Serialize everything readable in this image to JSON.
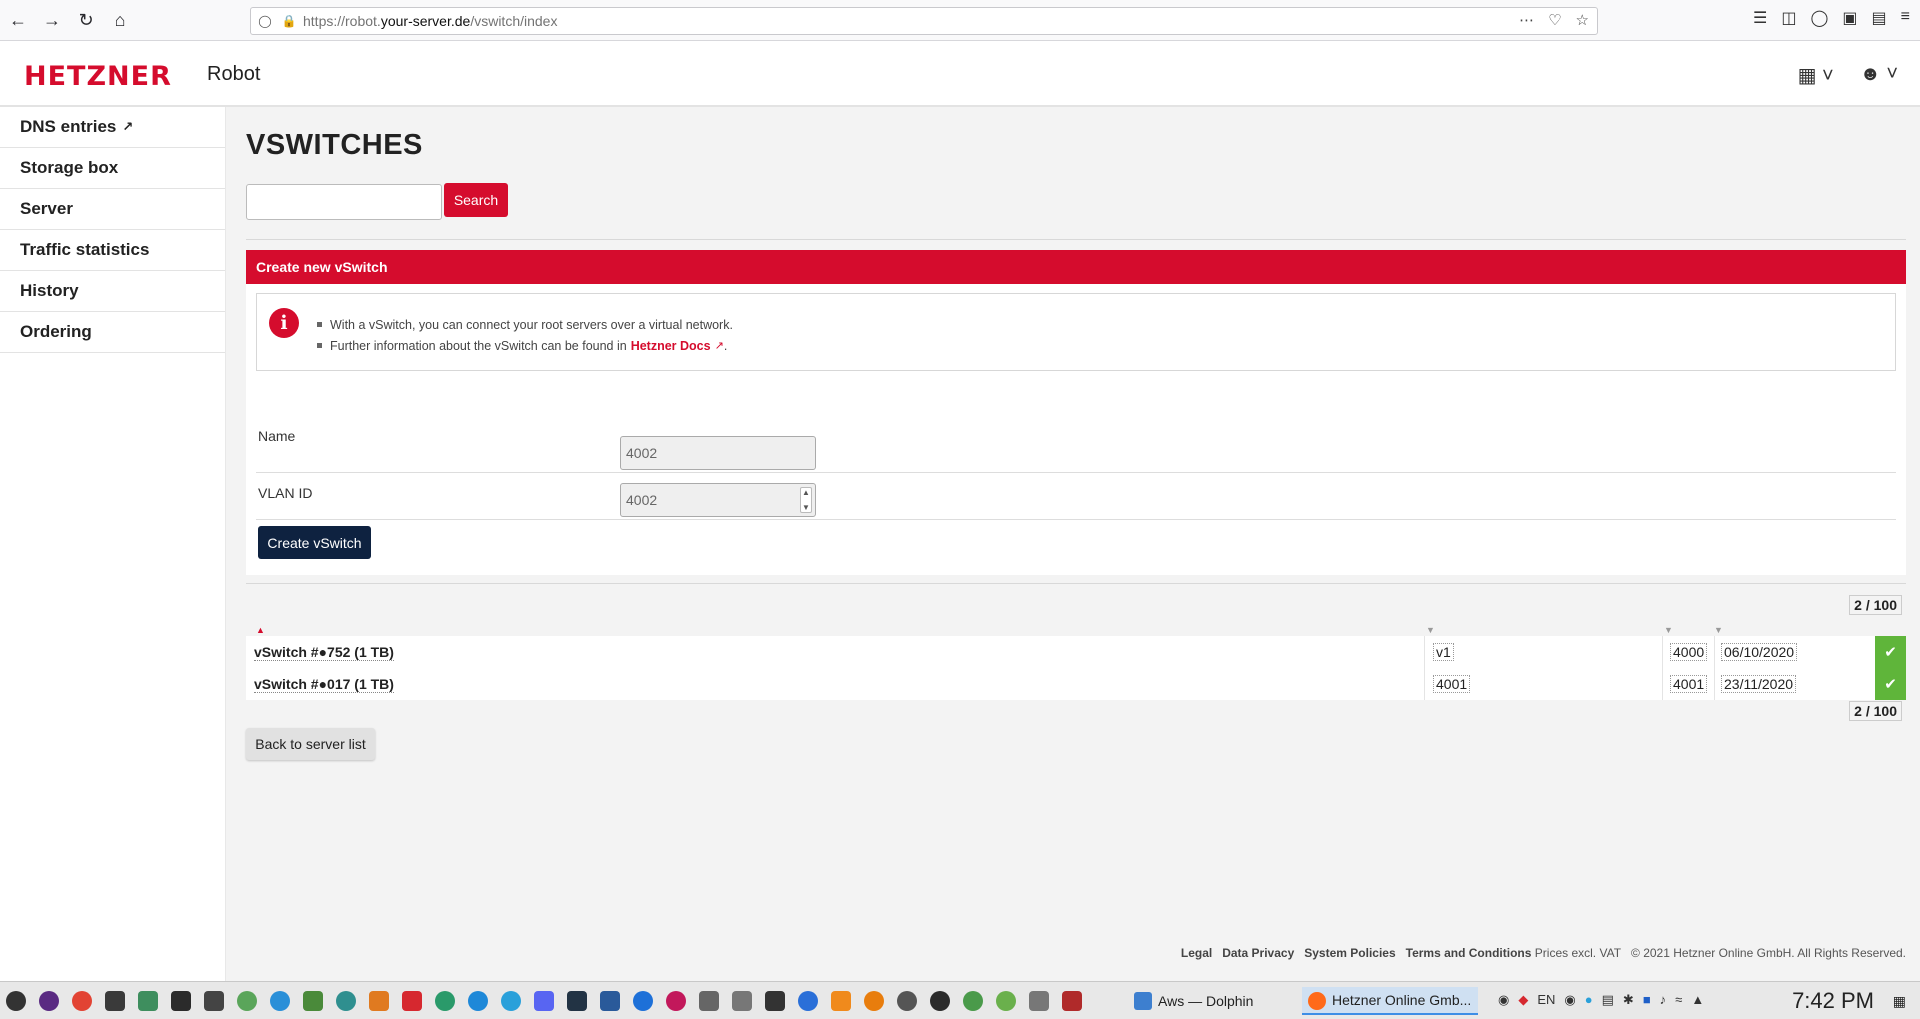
{
  "browser": {
    "url_prefix": "https://robot.",
    "url_host": "your-server.de",
    "url_path": "/vswitch/index"
  },
  "header": {
    "logo": "HETZNER",
    "app_name": "Robot"
  },
  "sidebar": {
    "items": [
      {
        "label": "DNS entries"
      },
      {
        "label": "Storage box"
      },
      {
        "label": "Server"
      },
      {
        "label": "Traffic statistics"
      },
      {
        "label": "History"
      },
      {
        "label": "Ordering"
      }
    ]
  },
  "main": {
    "title": "VSWITCHES",
    "search_button": "Search",
    "search_value": "",
    "panel": {
      "heading": "Create new vSwitch",
      "info_line1": "With a vSwitch, you can connect your root servers over a virtual network.",
      "info_line2_prefix": "Further information about the vSwitch can be found in",
      "info_link": "Hetzner Docs",
      "info_line2_suffix": ".",
      "name_label": "Name",
      "name_value": "4002",
      "vlan_label": "VLAN ID",
      "vlan_value": "4002",
      "create_button": "Create vSwitch"
    },
    "pager": "2 / 100",
    "rows": [
      {
        "name": "vSwitch #●752 (1 TB)",
        "server": "v1",
        "vlan": "4000",
        "date": "06/10/2020"
      },
      {
        "name": "vSwitch #●017 (1 TB)",
        "server": "4001",
        "vlan": "4001",
        "date": "23/11/2020"
      }
    ],
    "back_button": "Back to server list"
  },
  "footer": {
    "legal": "Legal",
    "privacy": "Data Privacy",
    "policies": "System Policies",
    "terms": "Terms and Conditions",
    "prices": "Prices excl. VAT",
    "copyright": "© 2021 Hetzner Online GmbH. All Rights Reserved."
  },
  "taskbar": {
    "window1": "Aws — Dolphin",
    "window2": "Hetzner Online Gmb...",
    "lang": "EN",
    "clock": "7:42 PM"
  },
  "colors": {
    "brand_red": "#d50c2d",
    "navy": "#0e2240",
    "ok_green": "#5fb53a"
  }
}
